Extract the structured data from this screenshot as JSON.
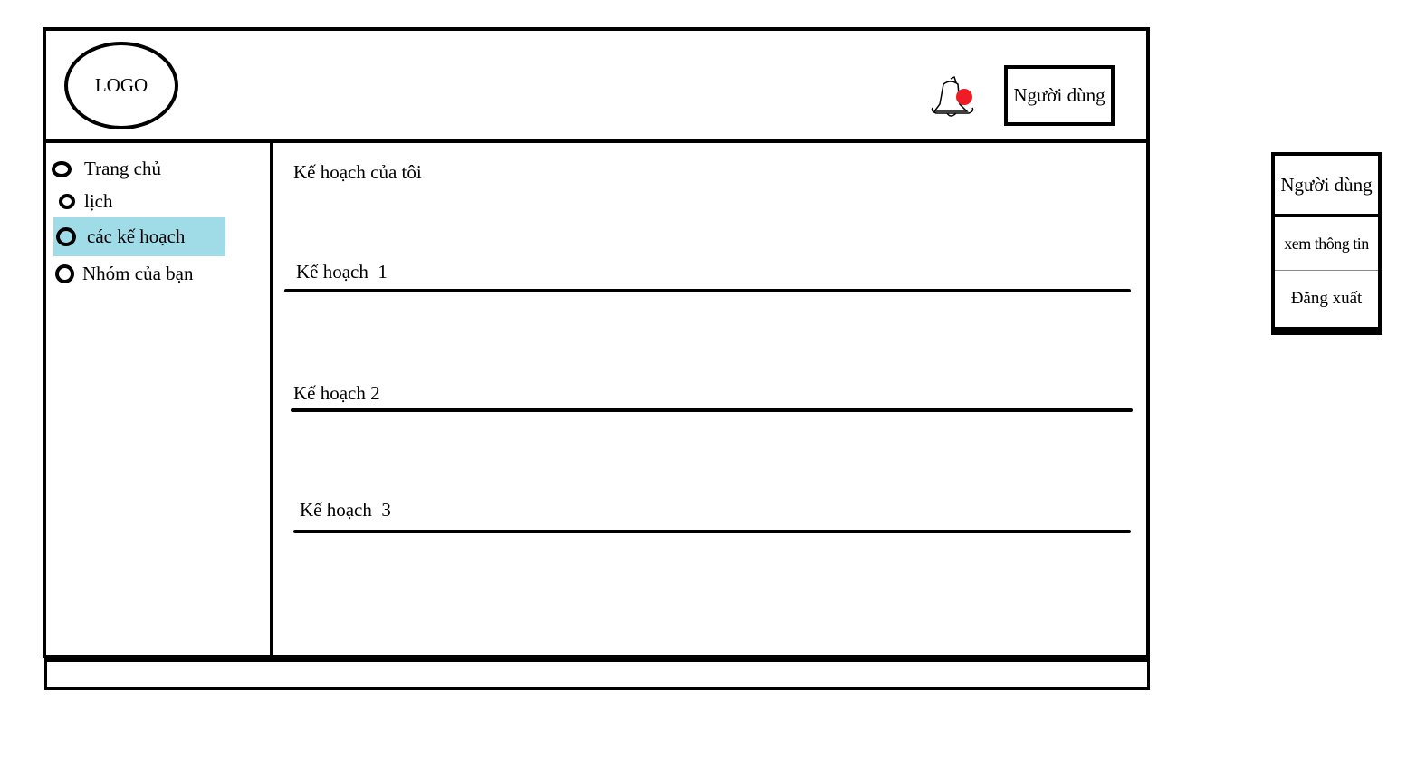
{
  "header": {
    "logo_text": "LOGO",
    "notification_icon": "bell-icon",
    "notification_dot_color": "#ee1c24",
    "user_label": "Người dùng"
  },
  "sidebar": {
    "active_color": "#a0dbe8",
    "items": [
      {
        "label": "Trang chủ",
        "icon": "circle-icon"
      },
      {
        "label": "lịch",
        "icon": "circle-icon"
      },
      {
        "label": "các kế hoạch",
        "icon": "circle-icon",
        "active": true
      },
      {
        "label": "Nhóm của bạn",
        "icon": "circle-icon"
      }
    ]
  },
  "main": {
    "title": "Kế hoạch của tôi",
    "plans": [
      {
        "label": "Kế hoạch  1"
      },
      {
        "label": "Kế hoạch 2"
      },
      {
        "label": "Kế hoạch  3"
      }
    ]
  },
  "user_menu": {
    "header": "Người dùng",
    "items": [
      {
        "label": "xem thông tin"
      },
      {
        "label": "Đăng xuất"
      }
    ]
  }
}
